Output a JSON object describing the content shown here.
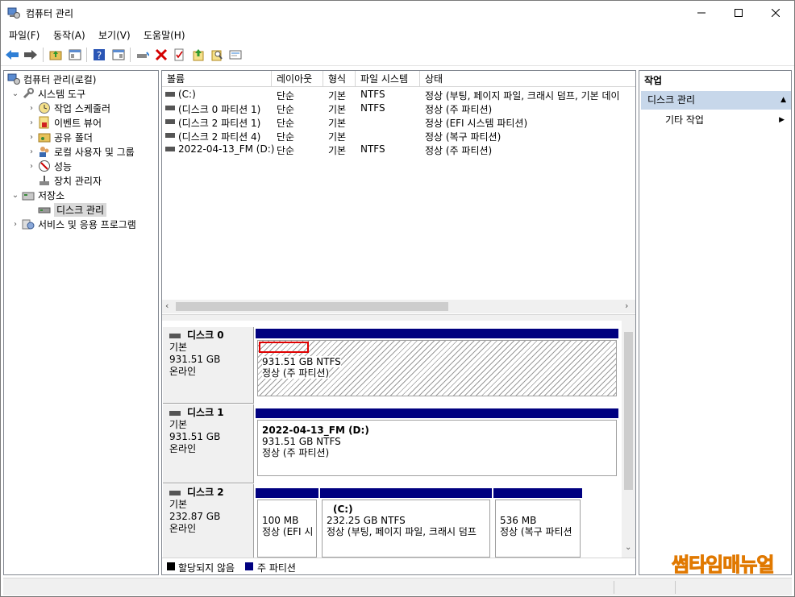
{
  "window": {
    "title": "컴퓨터 관리",
    "buttons": [
      "minimize",
      "maximize",
      "close"
    ]
  },
  "menu": [
    "파일(F)",
    "동작(A)",
    "보기(V)",
    "도움말(H)"
  ],
  "toolbar_icons": [
    "back-arrow-icon",
    "forward-arrow-icon",
    "up-folder-icon",
    "show-hide-tree-icon",
    "help-icon",
    "show-hide-action-icon",
    "connect-drive-icon",
    "delete-icon",
    "properties-icon",
    "open-icon",
    "search-icon",
    "dialog-icon"
  ],
  "tree": {
    "root": "컴퓨터 관리(로컬)",
    "system_tools": "시스템 도구",
    "task_scheduler": "작업 스케줄러",
    "event_viewer": "이벤트 뷰어",
    "shared_folders": "공유 폴더",
    "local_users": "로컬 사용자 및 그룹",
    "performance": "성능",
    "device_manager": "장치 관리자",
    "storage": "저장소",
    "disk_management": "디스크 관리",
    "services_apps": "서비스 및 응용 프로그램"
  },
  "volumes": {
    "headers": [
      "볼륨",
      "레이아웃",
      "형식",
      "파일 시스템",
      "상태"
    ],
    "rows": [
      {
        "volume": "(C:)",
        "layout": "단순",
        "type": "기본",
        "fs": "NTFS",
        "status": "정상 (부팅, 페이지 파일, 크래시 덤프, 기본 데이"
      },
      {
        "volume": "(디스크 0 파티션 1)",
        "layout": "단순",
        "type": "기본",
        "fs": "NTFS",
        "status": "정상 (주 파티션)"
      },
      {
        "volume": "(디스크 2 파티션 1)",
        "layout": "단순",
        "type": "기본",
        "fs": "",
        "status": "정상 (EFI 시스템 파티션)"
      },
      {
        "volume": "(디스크 2 파티션 4)",
        "layout": "단순",
        "type": "기본",
        "fs": "",
        "status": "정상 (복구 파티션)"
      },
      {
        "volume": "2022-04-13_FM (D:)",
        "layout": "단순",
        "type": "기본",
        "fs": "NTFS",
        "status": "정상 (주 파티션)"
      }
    ]
  },
  "disks": [
    {
      "name": "디스크 0",
      "kind": "기본",
      "size": "931.51 GB",
      "state": "온라인",
      "partitions": [
        {
          "title": "",
          "size": "931.51 GB NTFS",
          "status": "정상 (주 파티션)"
        }
      ]
    },
    {
      "name": "디스크 1",
      "kind": "기본",
      "size": "931.51 GB",
      "state": "온라인",
      "partitions": [
        {
          "title": "2022-04-13_FM  (D:)",
          "size": "931.51 GB NTFS",
          "status": "정상 (주 파티션)"
        }
      ]
    },
    {
      "name": "디스크 2",
      "kind": "기본",
      "size": "232.87 GB",
      "state": "온라인",
      "partitions": [
        {
          "title": "",
          "size": "100 MB",
          "status": "정상 (EFI 시"
        },
        {
          "title": "(C:)",
          "size": "232.25 GB NTFS",
          "status": "정상 (부팅, 페이지 파일, 크래시 덤프"
        },
        {
          "title": "",
          "size": "536 MB",
          "status": "정상 (복구 파티션"
        }
      ]
    }
  ],
  "legend": {
    "unallocated": "할당되지 않음",
    "primary": "주 파티션",
    "unallocated_color": "#000000",
    "primary_color": "#000080"
  },
  "actions": {
    "title": "작업",
    "section": "디스크 관리",
    "more": "기타 작업"
  },
  "watermark": "썸타임매뉴얼"
}
